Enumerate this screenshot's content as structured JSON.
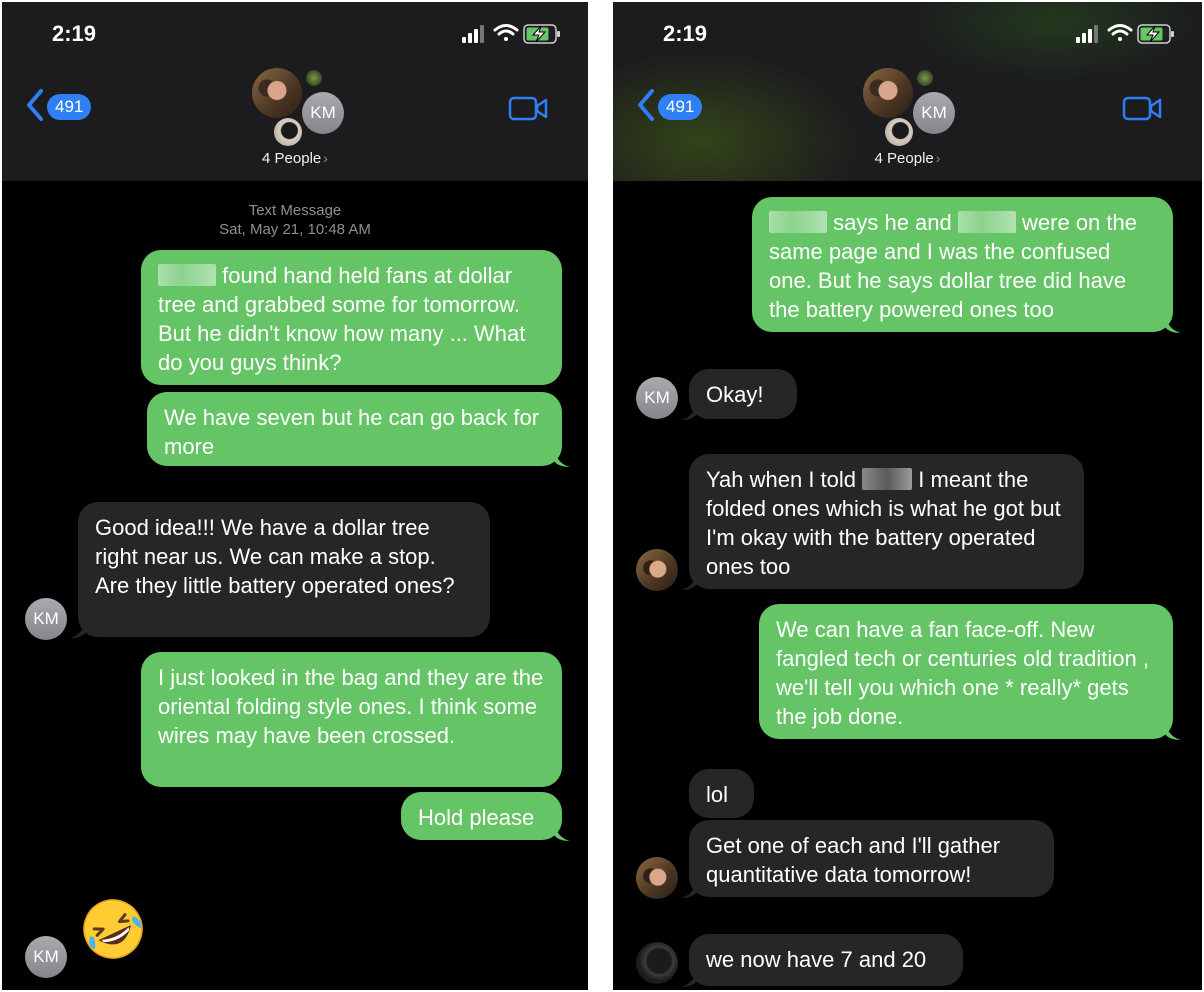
{
  "status": {
    "time": "2:19"
  },
  "header": {
    "back_count": "491",
    "group_title": "4 People",
    "km_initials": "KM"
  },
  "left": {
    "timestamp_label": "Text Message",
    "timestamp_date": "Sat, May 21, 10:48 AM",
    "messages": [
      {
        "from": "me",
        "text": "found hand held fans at dollar tree and grabbed some for tomorrow. But he didn't know how many ... What do you guys think?"
      },
      {
        "from": "me",
        "text": "We have seven but he can go back for more"
      },
      {
        "from": "KM",
        "text": "Good idea!!!  We have a dollar tree right near us. We can make a stop. Are they little battery operated ones?"
      },
      {
        "from": "me",
        "text": "I just looked in the bag and they are the oriental folding style ones. I think some wires may have been crossed."
      },
      {
        "from": "me",
        "text": "Hold please"
      },
      {
        "from": "KM",
        "text": "",
        "emoji": "rolling-on-floor-laughing"
      }
    ]
  },
  "right": {
    "messages": [
      {
        "from": "me",
        "parts": [
          "says he and",
          "were on the same page and I was the confused one. But he says dollar tree did have the battery powered ones too"
        ]
      },
      {
        "from": "KM",
        "text": "Okay!"
      },
      {
        "from": "photo",
        "parts": [
          "Yah when I told",
          "I meant the folded ones which is what he got but I'm okay with the battery operated ones too"
        ]
      },
      {
        "from": "me",
        "text": "We can have a fan face-off. New fangled tech or centuries old tradition , we'll tell you which one * really* gets the job done."
      },
      {
        "from": "photo",
        "text": "lol"
      },
      {
        "from": "photo",
        "text": "Get one of each and I'll gather quantitative data tomorrow!"
      },
      {
        "from": "dog",
        "text": "we now have 7 and 20"
      }
    ]
  },
  "colors": {
    "outgoing": "#65c466",
    "incoming": "#262628",
    "accent": "#2f7ff5"
  }
}
